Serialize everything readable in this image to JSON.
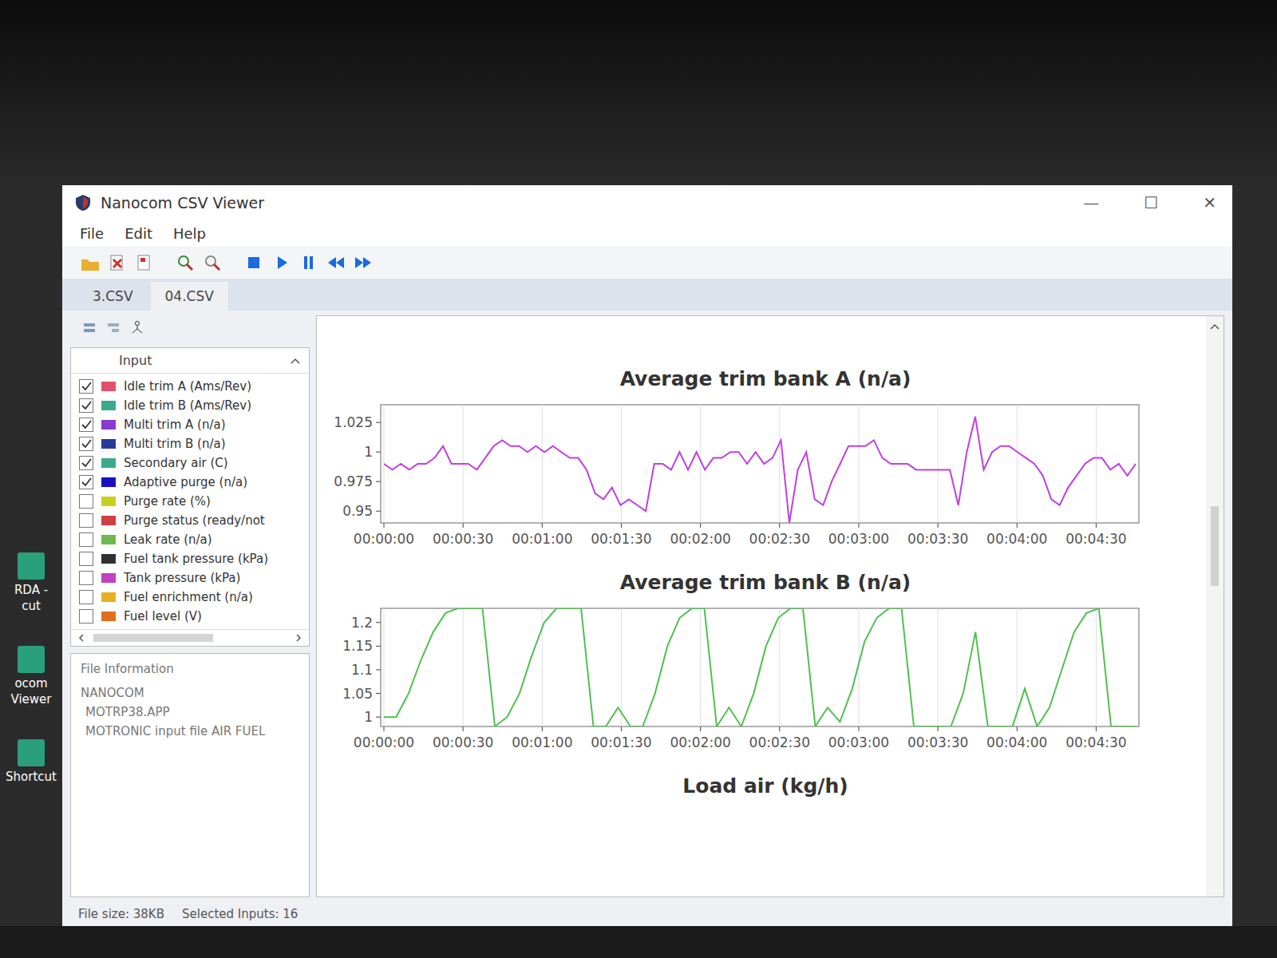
{
  "window": {
    "title": "Nanocom CSV Viewer",
    "controls": [
      "—",
      "☐",
      "✕"
    ]
  },
  "menu": [
    "File",
    "Edit",
    "Help"
  ],
  "tabs": [
    {
      "label": "3.CSV",
      "selected": false
    },
    {
      "label": "04.CSV",
      "selected": true
    }
  ],
  "inputs": {
    "header": "Input",
    "items": [
      {
        "label": "Idle trim A (Ams/Rev)",
        "checked": true,
        "color": "#e0506a"
      },
      {
        "label": "Idle trim B (Ams/Rev)",
        "checked": true,
        "color": "#3aaa8a"
      },
      {
        "label": "Multi trim A (n/a)",
        "checked": true,
        "color": "#8a3ad0"
      },
      {
        "label": "Multi trim B (n/a)",
        "checked": true,
        "color": "#2a3a9a"
      },
      {
        "label": "Secondary air (C)",
        "checked": true,
        "color": "#3aaa8a"
      },
      {
        "label": "Adaptive purge (n/a)",
        "checked": true,
        "color": "#1a10c0"
      },
      {
        "label": "Purge rate (%)",
        "checked": false,
        "color": "#c8d020"
      },
      {
        "label": "Purge status (ready/not",
        "checked": false,
        "color": "#d04040"
      },
      {
        "label": "Leak rate (n/a)",
        "checked": false,
        "color": "#70b850"
      },
      {
        "label": "Fuel tank pressure (kPa)",
        "checked": false,
        "color": "#303030"
      },
      {
        "label": "Tank pressure (kPa)",
        "checked": false,
        "color": "#c040c0"
      },
      {
        "label": "Fuel enrichment (n/a)",
        "checked": false,
        "color": "#e8b020"
      },
      {
        "label": "Fuel level (V)",
        "checked": false,
        "color": "#e07020"
      }
    ]
  },
  "file_info": {
    "title": "File Information",
    "lines": [
      "NANOCOM",
      "MOTRP38.APP",
      "MOTRONIC input file AIR FUEL"
    ]
  },
  "status_bar": [
    "File size: 38KB",
    "Selected Inputs: 16"
  ],
  "desktop_icons": [
    {
      "lines": [
        "RDA -",
        "cut"
      ]
    },
    {
      "lines": [
        "ocom",
        "Viewer"
      ]
    },
    {
      "lines": [
        "Shortcut"
      ]
    }
  ],
  "charts": [
    {
      "title": "Average trim bank A (n/a)",
      "color": "#c040e0",
      "y_ticks": [
        "1.025",
        "1",
        "0.975",
        "0.95"
      ],
      "x_ticks": [
        "00:00:00",
        "00:00:30",
        "00:01:00",
        "00:01:30",
        "00:02:00",
        "00:02:30",
        "00:03:00",
        "00:03:30",
        "00:04:00",
        "00:04:30"
      ],
      "values": [
        0.99,
        0.985,
        0.99,
        0.985,
        0.99,
        0.99,
        0.995,
        1.005,
        0.99,
        0.99,
        0.99,
        0.985,
        0.995,
        1.005,
        1.01,
        1.005,
        1.005,
        1.0,
        1.005,
        1.0,
        1.005,
        1.0,
        0.995,
        0.995,
        0.985,
        0.965,
        0.96,
        0.97,
        0.955,
        0.96,
        0.955,
        0.95,
        0.99,
        0.99,
        0.985,
        1.0,
        0.985,
        1.0,
        0.985,
        0.995,
        0.995,
        1.0,
        1.0,
        0.99,
        1.0,
        0.99,
        0.995,
        1.01,
        0.94,
        0.985,
        1.0,
        0.96,
        0.955,
        0.975,
        0.99,
        1.005,
        1.005,
        1.005,
        1.01,
        0.995,
        0.99,
        0.99,
        0.99,
        0.985,
        0.985,
        0.985,
        0.985,
        0.985,
        0.955,
        1.0,
        1.03,
        0.985,
        1.0,
        1.005,
        1.005,
        1.0,
        0.995,
        0.99,
        0.98,
        0.96,
        0.955,
        0.97,
        0.98,
        0.99,
        0.995,
        0.995,
        0.985,
        0.99,
        0.98,
        0.99
      ]
    },
    {
      "title": "Average trim bank B (n/a)",
      "color": "#50c050",
      "y_ticks": [
        "1.2",
        "1.15",
        "1.1",
        "1.05",
        "1"
      ],
      "x_ticks": [
        "00:00:00",
        "00:00:30",
        "00:01:00",
        "00:01:30",
        "00:02:00",
        "00:02:30",
        "00:03:00",
        "00:03:30",
        "00:04:00",
        "00:04:30"
      ],
      "values": [
        1.0,
        1.0,
        1.05,
        1.12,
        1.18,
        1.22,
        1.23,
        1.23,
        1.23,
        0.95,
        1.0,
        1.05,
        1.13,
        1.2,
        1.23,
        1.23,
        1.23,
        0.95,
        0.95,
        1.02,
        0.95,
        0.95,
        1.05,
        1.15,
        1.21,
        1.23,
        1.23,
        0.95,
        1.02,
        0.98,
        1.05,
        1.15,
        1.21,
        1.23,
        1.23,
        0.95,
        1.02,
        0.99,
        1.06,
        1.16,
        1.21,
        1.23,
        1.23,
        0.95,
        0.95,
        0.95,
        0.95,
        1.05,
        1.18,
        0.95,
        0.95,
        0.95,
        1.06,
        0.98,
        1.02,
        1.1,
        1.18,
        1.22,
        1.23,
        0.95,
        0.95,
        0.95
      ]
    },
    {
      "title": "Load air (kg/h)"
    }
  ]
}
